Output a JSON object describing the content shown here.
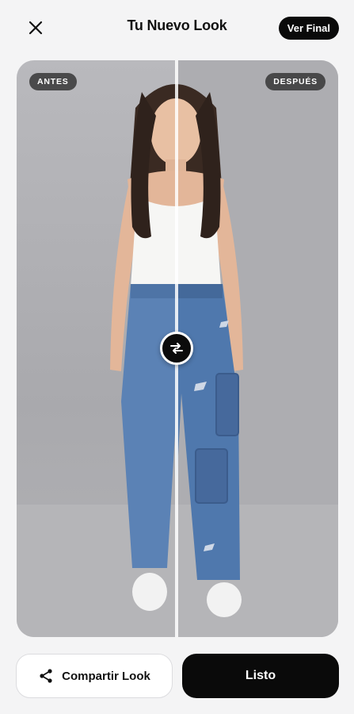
{
  "header": {
    "close_icon": "close-icon",
    "title": "Tu Nuevo Look",
    "final_button": "Ver Final"
  },
  "compare": {
    "before_label": "ANTES",
    "after_label": "DESPUÉS",
    "handle_icon": "swap-arrows-icon",
    "split_position": 0.5
  },
  "actions": {
    "share_label": "Compartir Look",
    "share_icon": "share-icon",
    "done_label": "Listo"
  },
  "colors": {
    "primary": "#0a0a0a",
    "denim": "#4f78ad",
    "background": "#f4f4f5"
  }
}
